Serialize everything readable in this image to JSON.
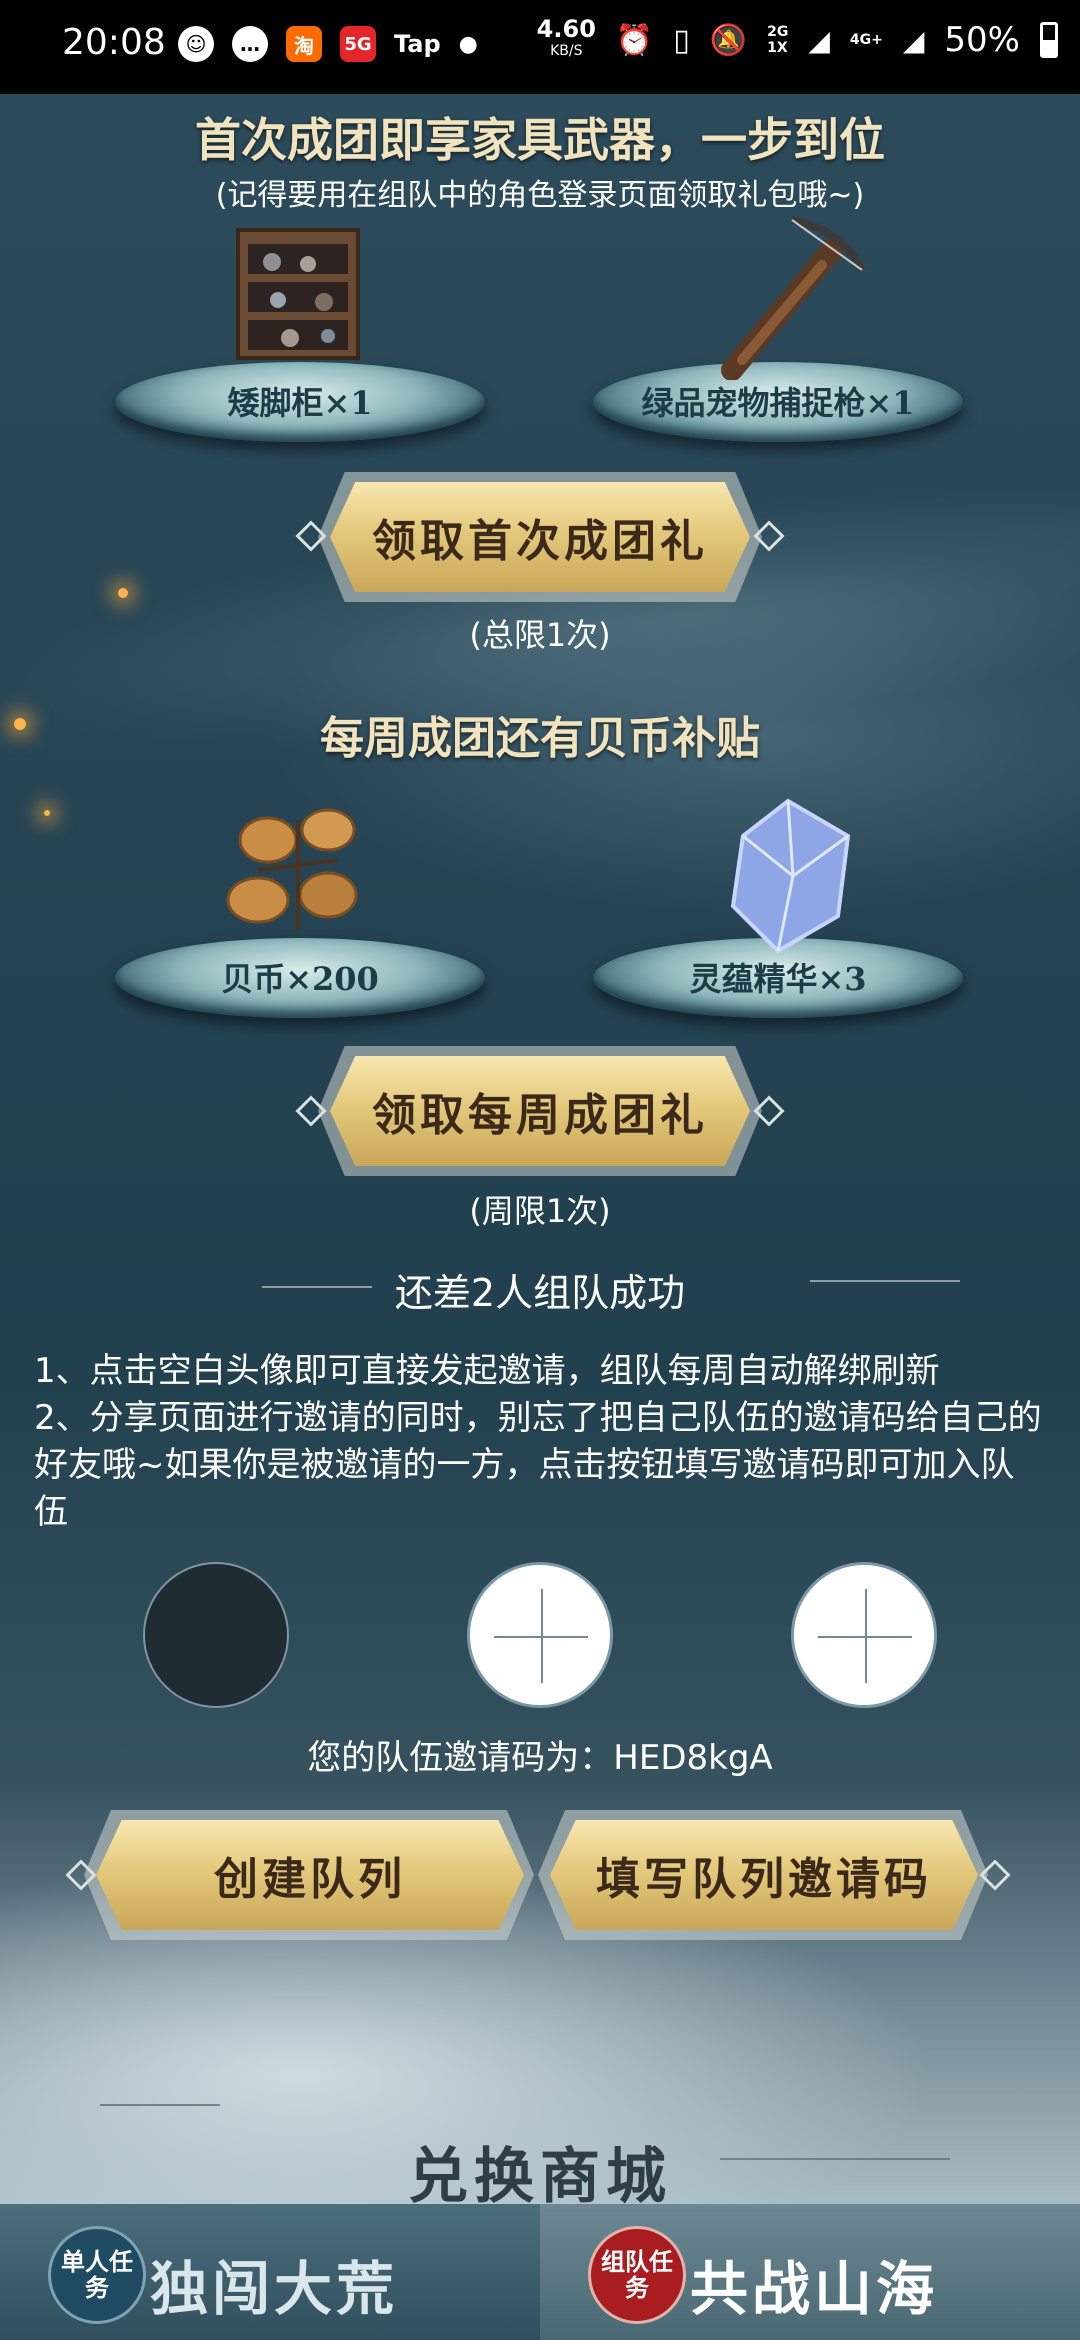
{
  "status_bar": {
    "time": "20:08",
    "app_icons": [
      "qq-icon",
      "message-icon",
      "taobao-icon",
      "5g-icon",
      "tap-icon",
      "dot-icon"
    ],
    "tap_label": "Tap",
    "network_speed": "4.60",
    "network_speed_unit": "KB/S",
    "network_type_top": "2G",
    "network_type_bottom": "1X",
    "signal_4g": "4G+",
    "battery": "50%"
  },
  "first_team": {
    "title": "首次成团即享家具武器，一步到位",
    "subtitle": "(记得要用在组队中的角色登录页面领取礼包哦~)",
    "items": [
      {
        "label": "矮脚柜×1",
        "icon": "cabinet-icon"
      },
      {
        "label": "绿品宠物捕捉枪×1",
        "icon": "crossbow-icon"
      }
    ],
    "button": "领取首次成团礼",
    "limit": "(总限1次)"
  },
  "weekly_team": {
    "title": "每周成团还有贝币补贴",
    "items": [
      {
        "label": "贝币×200",
        "icon": "shell-coin-icon"
      },
      {
        "label": "灵蕴精华×3",
        "icon": "crystal-icon"
      }
    ],
    "button": "领取每周成团礼",
    "limit": "(周限1次)"
  },
  "team": {
    "status": "还差2人组队成功",
    "rules": [
      "1、点击空白头像即可直接发起邀请，组队每周自动解绑刷新",
      "2、分享页面进行邀请的同时，别忘了把自己队伍的邀请码给自己的好友哦~如果你是被邀请的一方，点击按钮填写邀请码即可加入队伍"
    ],
    "invite_code_text": "您的队伍邀请码为：HED8kgA",
    "create_button": "创建队列",
    "fill_button": "填写队列邀请码"
  },
  "mall_title": "兑换商城",
  "tabs": [
    {
      "badge": "单人任务",
      "label": "独闯大荒"
    },
    {
      "badge": "组队任务",
      "label": "共战山海"
    }
  ],
  "colors": {
    "gold_button": "#e4c97c",
    "heading": "#f1e3bd",
    "background": "#264453"
  }
}
